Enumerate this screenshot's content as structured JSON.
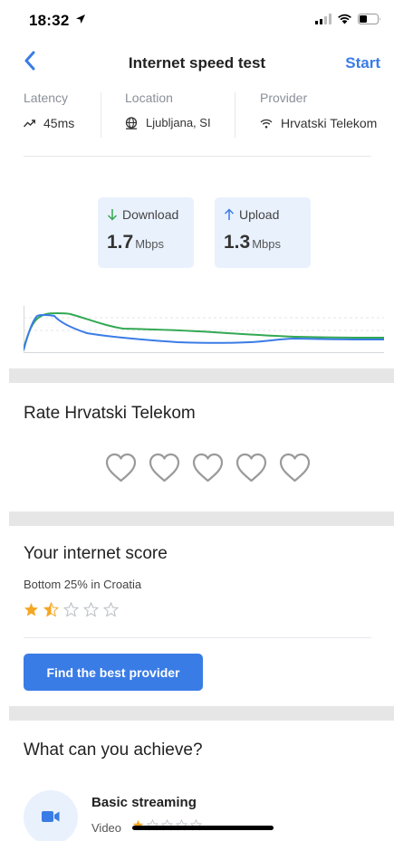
{
  "status_bar": {
    "time": "18:32"
  },
  "nav": {
    "title": "Internet speed test",
    "start_label": "Start"
  },
  "meta": {
    "latency_label": "Latency",
    "latency_value": "45ms",
    "location_label": "Location",
    "location_value": "Ljubljana, SI",
    "provider_label": "Provider",
    "provider_value": "Hrvatski Telekom"
  },
  "speed": {
    "download_label": "Download",
    "download_value": "1.7",
    "download_unit": "Mbps",
    "upload_label": "Upload",
    "upload_value": "1.3",
    "upload_unit": "Mbps"
  },
  "rating": {
    "title": "Rate Hrvatski Telekom",
    "hearts_total": 5
  },
  "score": {
    "title": "Your internet score",
    "subtitle": "Bottom 25% in Croatia",
    "stars_value": 1.5,
    "stars_total": 5
  },
  "cta": {
    "label": "Find the best provider"
  },
  "achieve": {
    "title": "What can you achieve?",
    "items": [
      {
        "name": "Basic streaming",
        "category": "Video",
        "icon": "video-camera-icon"
      }
    ]
  },
  "colors": {
    "accent": "#3a7ce6",
    "upload_line": "#3a7ce6",
    "download_line": "#33a853",
    "star": "#f5a623",
    "box_bg": "#e9f1fd"
  }
}
